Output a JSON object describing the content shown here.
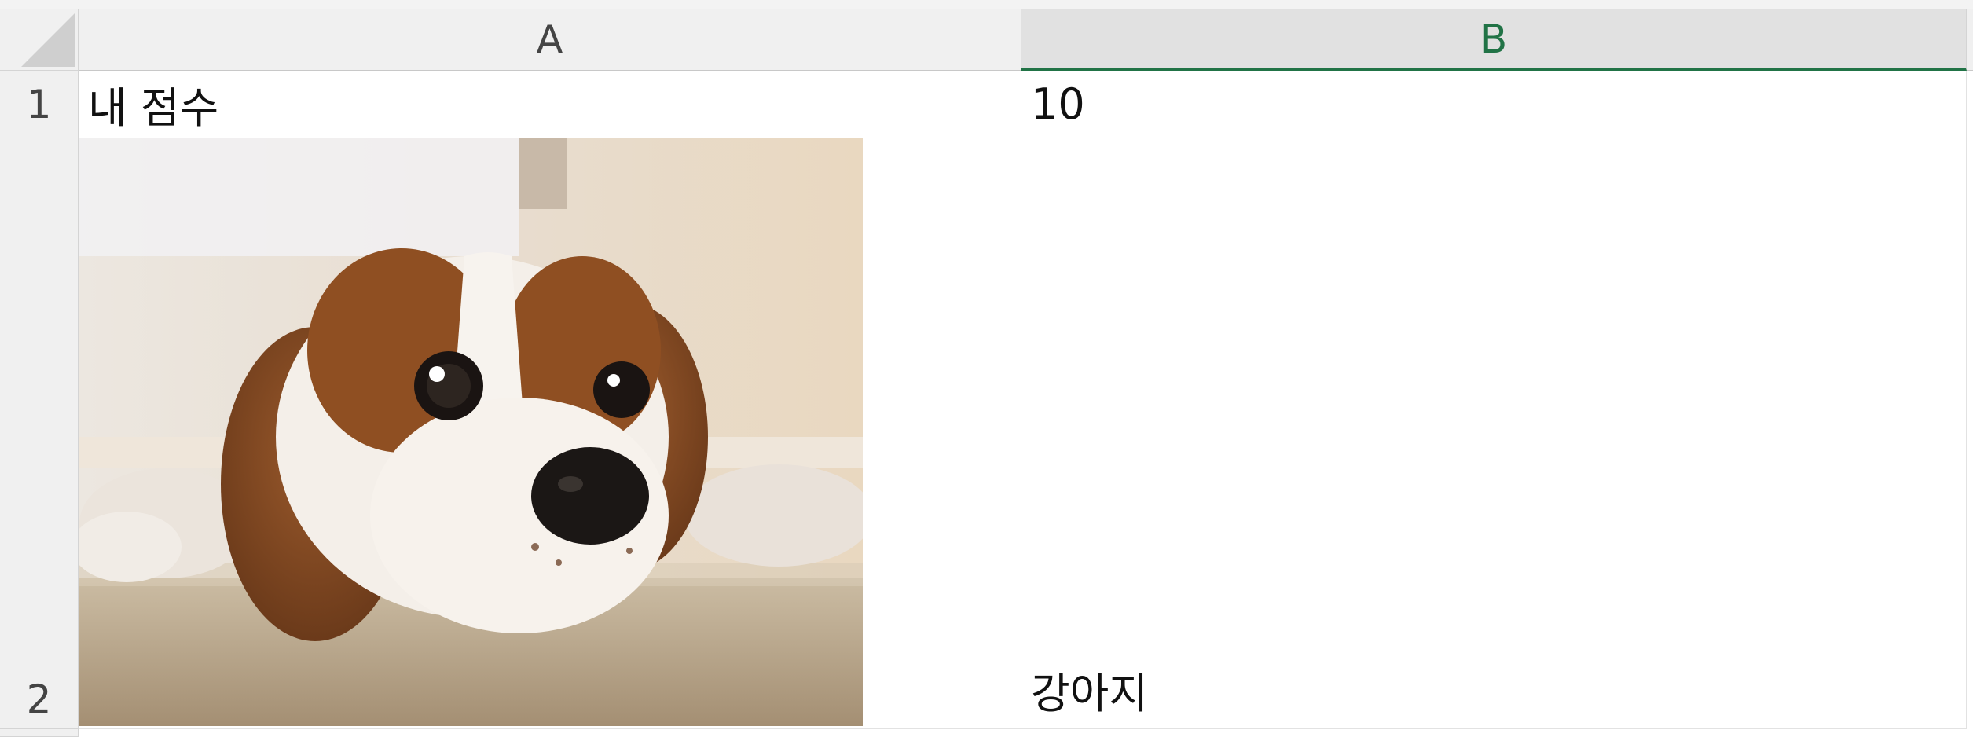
{
  "sheet": {
    "columns": [
      {
        "label": "A",
        "selected": false
      },
      {
        "label": "B",
        "selected": true
      }
    ],
    "rows": [
      {
        "label": "1"
      },
      {
        "label": "2"
      }
    ],
    "cells": {
      "A1": "내 점수",
      "B1": "10",
      "B2": "강아지"
    },
    "image": {
      "subject": "cavalier-spaniel-puppy-photo",
      "anchor_cell": "A2"
    }
  },
  "colors": {
    "selected_accent": "#217346",
    "header_bg": "#f0f0f0",
    "gridline": "#e2e2e2"
  }
}
